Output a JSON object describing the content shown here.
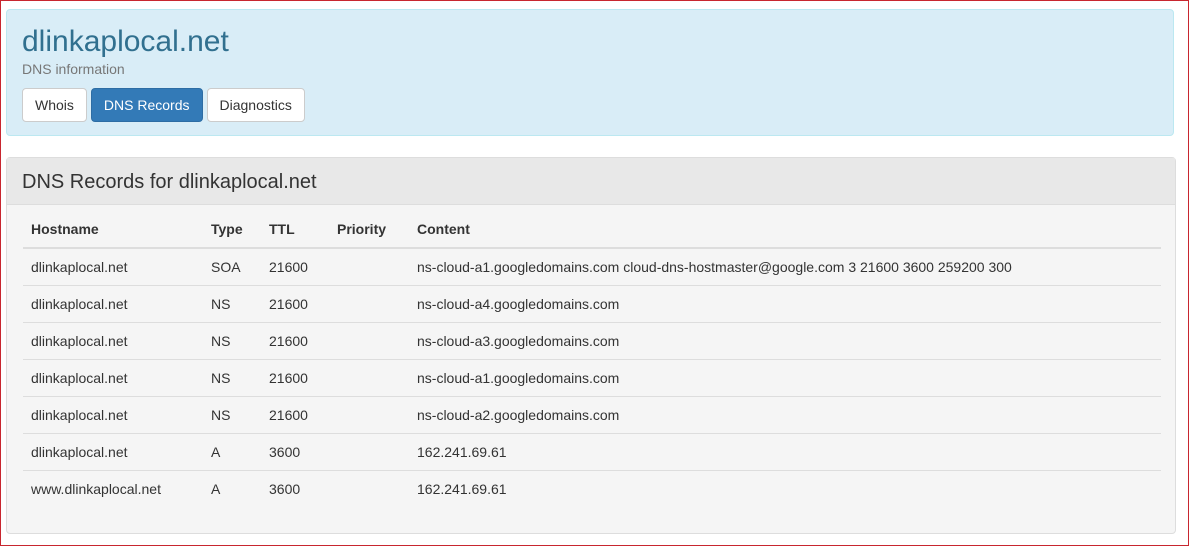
{
  "header": {
    "title": "dlinkaplocal.net",
    "subtitle": "DNS information",
    "tabs": [
      {
        "label": "Whois",
        "active": false
      },
      {
        "label": "DNS Records",
        "active": true
      },
      {
        "label": "Diagnostics",
        "active": false
      }
    ]
  },
  "records": {
    "heading": "DNS Records for dlinkaplocal.net",
    "columns": [
      "Hostname",
      "Type",
      "TTL",
      "Priority",
      "Content"
    ],
    "rows": [
      {
        "hostname": "dlinkaplocal.net",
        "type": "SOA",
        "ttl": "21600",
        "priority": "",
        "content": "ns-cloud-a1.googledomains.com cloud-dns-hostmaster@google.com 3 21600 3600 259200 300"
      },
      {
        "hostname": "dlinkaplocal.net",
        "type": "NS",
        "ttl": "21600",
        "priority": "",
        "content": "ns-cloud-a4.googledomains.com"
      },
      {
        "hostname": "dlinkaplocal.net",
        "type": "NS",
        "ttl": "21600",
        "priority": "",
        "content": "ns-cloud-a3.googledomains.com"
      },
      {
        "hostname": "dlinkaplocal.net",
        "type": "NS",
        "ttl": "21600",
        "priority": "",
        "content": "ns-cloud-a1.googledomains.com"
      },
      {
        "hostname": "dlinkaplocal.net",
        "type": "NS",
        "ttl": "21600",
        "priority": "",
        "content": "ns-cloud-a2.googledomains.com"
      },
      {
        "hostname": "dlinkaplocal.net",
        "type": "A",
        "ttl": "3600",
        "priority": "",
        "content": "162.241.69.61"
      },
      {
        "hostname": "www.dlinkaplocal.net",
        "type": "A",
        "ttl": "3600",
        "priority": "",
        "content": "162.241.69.61"
      }
    ]
  },
  "colors": {
    "header_bg": "#d9edf7",
    "title": "#31708f",
    "active_tab": "#337ab7",
    "frame_border": "#c8262f"
  }
}
